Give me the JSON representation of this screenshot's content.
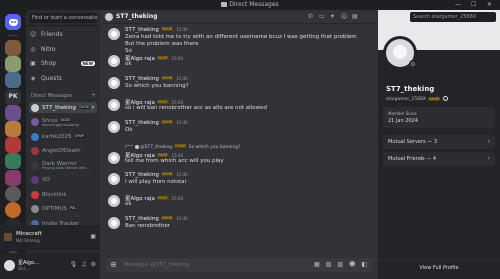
{
  "window": {
    "title": "Direct Messages",
    "controls": [
      "—",
      "☐",
      "✕"
    ]
  },
  "rail": {
    "servers": [
      {
        "name": "home-server",
        "color": "#5865f2"
      },
      {
        "name": "server-1",
        "color": "#7c5a3a"
      },
      {
        "name": "server-2",
        "color": "#8a9b6e"
      },
      {
        "name": "server-3",
        "color": "#4c6b8a"
      },
      {
        "name": "server-pk",
        "text": "PK"
      },
      {
        "name": "server-5",
        "color": "#6b4f8a"
      },
      {
        "name": "server-6",
        "color": "#b57a3c"
      },
      {
        "name": "server-7",
        "color": "#b03a3a"
      },
      {
        "name": "server-8",
        "color": "#3a7a5a"
      },
      {
        "name": "server-9",
        "color": "#8a3a6b"
      },
      {
        "name": "server-10",
        "color": "#5a5a5a"
      },
      {
        "name": "server-11",
        "color": "#c06a2a"
      },
      {
        "name": "server-12",
        "color": "#2a2a2a"
      },
      {
        "name": "server-13",
        "color": "#7a7a2a"
      },
      {
        "name": "server-14",
        "color": "#444"
      },
      {
        "name": "server-15",
        "color": "#333"
      }
    ]
  },
  "sidebar": {
    "search_placeholder": "Find or start a conversation",
    "nav": [
      {
        "label": "Friends",
        "icon": "friends-icon",
        "glyph": "☺"
      },
      {
        "label": "Nitro",
        "icon": "nitro-icon",
        "glyph": "◎"
      },
      {
        "label": "Shop",
        "icon": "shop-icon",
        "glyph": "▣",
        "badge": "NEW"
      },
      {
        "label": "Quests",
        "icon": "quests-icon",
        "glyph": "◈"
      }
    ],
    "dm_header": "Direct Messages",
    "dm_add": "+",
    "dms": [
      {
        "name": "ST7_theking",
        "tag": "GOOE",
        "color": "#c9ccd1",
        "active": true
      },
      {
        "name": "Shrus",
        "tag": "GOAT",
        "sub": "discord.gg/rvxsswmp",
        "color": "#7a5a9a"
      },
      {
        "name": "kartik2025",
        "tag": "VFNP",
        "color": "#3a7acc"
      },
      {
        "name": "AngleOfDeath",
        "color": "#9a3a3a"
      },
      {
        "name": "Dark Warrior",
        "sub": "Playing Dark Warrior Idle...",
        "color": "#3a3a3a"
      },
      {
        "name": "XO",
        "color": "#5a3a7a"
      },
      {
        "name": "Blocklink",
        "color": "#cc3a3a"
      },
      {
        "name": "OPTIMUS",
        "tag": "PXL",
        "color": "#8a8a8a"
      },
      {
        "name": "Invite Tracker",
        "color": "#4a6a9a"
      }
    ]
  },
  "activity": {
    "title": "Minecraft",
    "status": "Not Sharing"
  },
  "user": {
    "name": "星Algo…",
    "status": "Onl…",
    "icons": [
      "mic-icon",
      "headphones-icon",
      "settings-icon"
    ]
  },
  "chat": {
    "recipient": "ST7_theking",
    "recipient_tag": "GOOE",
    "header_icons": [
      "call-icon",
      "video-icon",
      "pin-icon",
      "add-friend-icon",
      "profile-toggle-icon"
    ],
    "search_placeholder": "Search stargamer_2568X",
    "messages": [
      {
        "author": "ST7_theking",
        "tag": "GOOE",
        "time": "15:46",
        "lines": [
          "Zeira had told me to try with an different username bcuz I was getting that problem",
          "But the problem was there",
          "So"
        ]
      },
      {
        "author": "星Algo raja",
        "tag": "GOAT",
        "time": "15:46",
        "lines": [
          "ok"
        ]
      },
      {
        "author": "ST7_theking",
        "tag": "GOOE",
        "time": "15:46",
        "lines": [
          "So which you banning?"
        ]
      },
      {
        "author": "星Algo raja",
        "tag": "GOAT",
        "time": "15:46",
        "lines": [
          "so i will ban renobrother acc as alts are not allowed"
        ]
      },
      {
        "author": "ST7_theking",
        "tag": "GOOE",
        "time": "15:46",
        "lines": [
          "Ok"
        ]
      },
      {
        "reply_to": "@ST7_theking",
        "reply_tag": "GOOE",
        "reply_text": "So which you banning?",
        "author": "星Algo raja",
        "tag": "GOAT",
        "time": "15:46",
        "lines": [
          "tell me from which acc will you play"
        ]
      },
      {
        "author": "ST7_theking",
        "tag": "GOOE",
        "time": "15:46",
        "lines": [
          "I will play from notstar"
        ]
      },
      {
        "author": "星Algo raja",
        "tag": "GOAT",
        "time": "15:46",
        "lines": [
          "ok"
        ]
      },
      {
        "author": "ST7_theking",
        "tag": "GOOE",
        "time": "15:46",
        "lines": [
          "Ban renobrother"
        ]
      }
    ],
    "composer_placeholder": "Message @ST7_theking",
    "composer_icons": [
      "gift-icon",
      "gif-icon",
      "sticker-icon",
      "emoji-icon",
      "apps-icon"
    ]
  },
  "profile": {
    "name": "ST7_theking",
    "handle": "stargamer_2568X",
    "tag": "GOOE",
    "member_since_label": "Member Since",
    "member_since": "21 Jan 2024",
    "mutual_servers": "Mutual Servers — 3",
    "mutual_friends": "Mutual Friends — 4",
    "view_full": "View Full Profile"
  }
}
